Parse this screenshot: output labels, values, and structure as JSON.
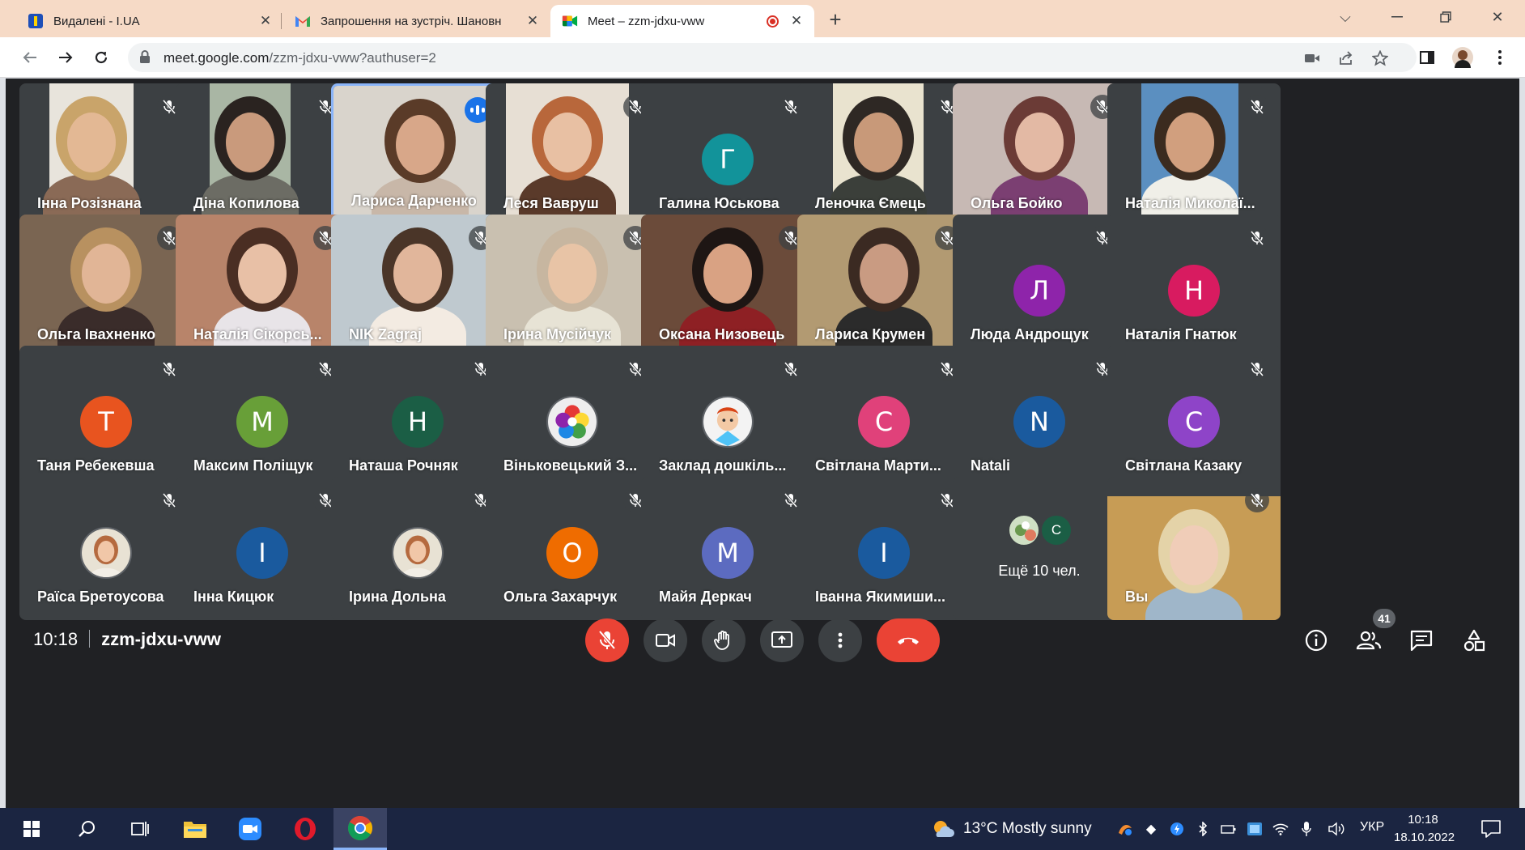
{
  "browser": {
    "tabs": [
      {
        "title": "Видалені - I.UA",
        "favicon": "iua-icon",
        "active": false
      },
      {
        "title": "Запрошення на зустріч. Шановн",
        "favicon": "gmail-icon",
        "active": false
      },
      {
        "title": "Meet – zzm-jdxu-vww",
        "favicon": "meet-icon",
        "active": true
      }
    ],
    "url_host": "meet.google.com",
    "url_path": "/zzm-jdxu-vww?authuser=2"
  },
  "meet": {
    "tiles": [
      {
        "name": "Інна Розізнана",
        "kind": "video"
      },
      {
        "name": "Діна Копилова",
        "kind": "video"
      },
      {
        "name": "Лариса Дарченко",
        "kind": "video",
        "speaking": true
      },
      {
        "name": "Леся Вавруш",
        "kind": "video"
      },
      {
        "name": "Галина Юськова",
        "kind": "avatar",
        "initial": "Г",
        "color": "#12939a"
      },
      {
        "name": "Леночка Ємець",
        "kind": "video"
      },
      {
        "name": "Ольга Бойко",
        "kind": "video"
      },
      {
        "name": "Наталія Миколаї...",
        "kind": "video"
      },
      {
        "name": "Ольга Івахненко",
        "kind": "video"
      },
      {
        "name": "Наталія Сікорсь...",
        "kind": "video"
      },
      {
        "name": "NIK Zagraj",
        "kind": "video"
      },
      {
        "name": "Ірина Мусійчук",
        "kind": "video"
      },
      {
        "name": "Оксана Низовець",
        "kind": "video"
      },
      {
        "name": "Лариса Крумен",
        "kind": "video"
      },
      {
        "name": "Люда Андрощук",
        "kind": "avatar",
        "initial": "Л",
        "color": "#8e24aa"
      },
      {
        "name": "Наталія Гнатюк",
        "kind": "avatar",
        "initial": "Н",
        "color": "#d81b60"
      },
      {
        "name": "Таня Ребекевша",
        "kind": "avatar",
        "initial": "Т",
        "color": "#e8541f"
      },
      {
        "name": "Максим Поліщук",
        "kind": "avatar",
        "initial": "М",
        "color": "#689f38"
      },
      {
        "name": "Наташа Рочняк",
        "kind": "avatar",
        "initial": "Н",
        "color": "#1b5e45"
      },
      {
        "name": "Віньковецький З...",
        "kind": "image-avatar",
        "image": "flower-logo"
      },
      {
        "name": "Заклад дошкіль...",
        "kind": "image-avatar",
        "image": "cartoon-boy"
      },
      {
        "name": "Світлана Марти...",
        "kind": "avatar",
        "initial": "С",
        "color": "#e0417a"
      },
      {
        "name": "Natali",
        "kind": "avatar",
        "initial": "N",
        "color": "#1a5a9e"
      },
      {
        "name": "Світлана Казаку",
        "kind": "avatar",
        "initial": "С",
        "color": "#8e44c8"
      },
      {
        "name": "Раїса Бретоусова",
        "kind": "image-avatar",
        "image": "portrait"
      },
      {
        "name": "Інна Кицюк",
        "kind": "avatar",
        "initial": "І",
        "color": "#1a5a9e"
      },
      {
        "name": "Ірина Дольна",
        "kind": "image-avatar",
        "image": "portrait-2"
      },
      {
        "name": "Ольга Захарчук",
        "kind": "avatar",
        "initial": "О",
        "color": "#ef6c00"
      },
      {
        "name": "Майя Деркач",
        "kind": "avatar",
        "initial": "М",
        "color": "#5c6bc0"
      },
      {
        "name": "Іванна Якимиши...",
        "kind": "avatar",
        "initial": "І",
        "color": "#1a5a9e"
      },
      {
        "name": "",
        "kind": "more",
        "more_text": "Ещё 10 чел.",
        "mini_initial": "C"
      },
      {
        "name": "Вы",
        "kind": "video"
      }
    ],
    "time": "10:18",
    "meeting_code": "zzm-jdxu-vww",
    "people_count": "41",
    "colors": {
      "background": "#202124",
      "tile": "#3c4043",
      "danger": "#ea4335",
      "speaking": "#8ab4f8"
    }
  },
  "taskbar": {
    "weather": "13°C  Mostly sunny",
    "lang": "УКР",
    "time": "10:18",
    "date": "18.10.2022"
  }
}
